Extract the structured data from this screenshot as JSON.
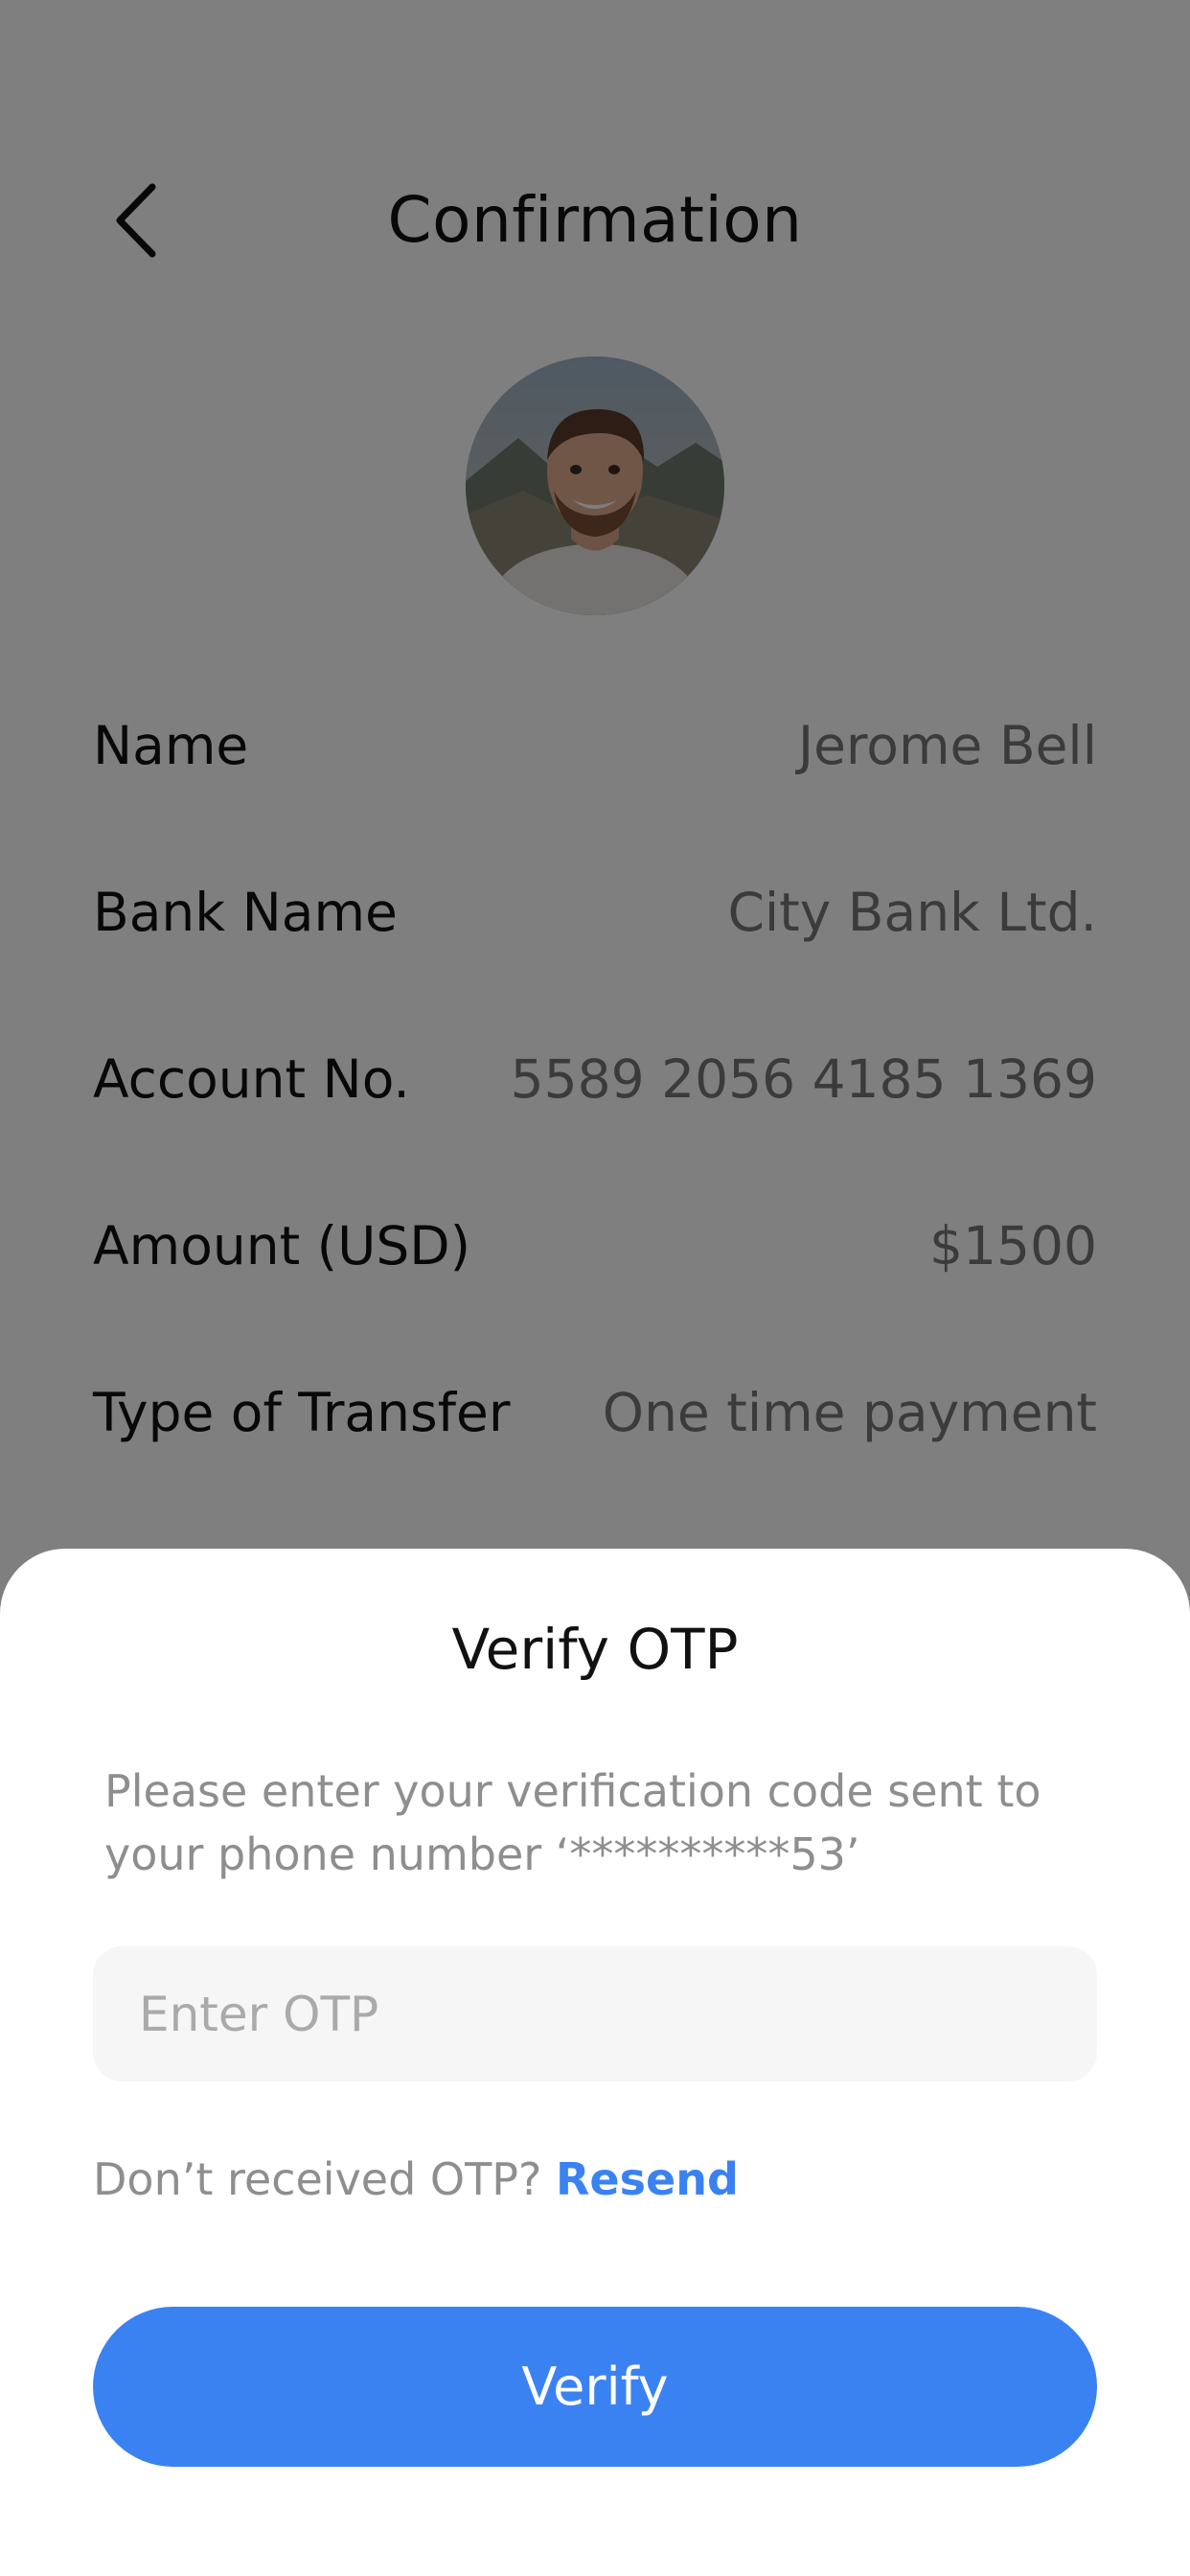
{
  "header": {
    "title": "Confirmation",
    "back_icon": "chevron-left-icon"
  },
  "recipient": {
    "avatar": "avatar-photo",
    "details": [
      {
        "label": "Name",
        "value": "Jerome Bell"
      },
      {
        "label": "Bank Name",
        "value": "City Bank Ltd."
      },
      {
        "label": "Account No.",
        "value": "5589 2056 4185 1369"
      },
      {
        "label": "Amount (USD)",
        "value": "$1500"
      },
      {
        "label": "Type of Transfer",
        "value": "One time payment"
      }
    ]
  },
  "otp_sheet": {
    "title": "Verify OTP",
    "message": "Please enter your verification code sent to your phone number ‘**********53’",
    "input_placeholder": "Enter OTP",
    "input_value": "",
    "resend_prompt": "Don’t received OTP?",
    "resend_label": "Resend",
    "verify_label": "Verify"
  },
  "colors": {
    "accent": "#3a82f1",
    "overlay": "#00000080",
    "sheet_background": "#ffffff",
    "input_background": "#f6f6f6"
  }
}
